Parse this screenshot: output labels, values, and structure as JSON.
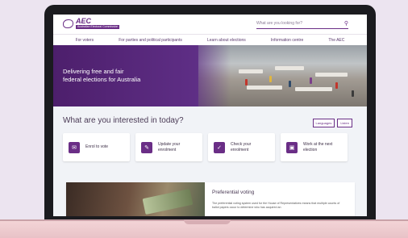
{
  "header": {
    "logo_text": "AEC",
    "logo_sub": "Australian Electoral Commission",
    "search_placeholder": "What are you looking for?"
  },
  "nav": {
    "items": [
      "For voters",
      "For parties and political participants",
      "Learn about elections",
      "Information centre",
      "The AEC"
    ]
  },
  "hero": {
    "line1": "Delivering free and fair",
    "line2": "federal elections for Australia"
  },
  "interest": {
    "heading": "What are you interested in today?",
    "toggle_languages": "Languages",
    "toggle_listen": "Listen"
  },
  "cards": [
    {
      "label": "Enrol to vote",
      "icon": "ballot-icon"
    },
    {
      "label": "Update your enrolment",
      "icon": "edit-icon"
    },
    {
      "label": "Check your enrolment",
      "icon": "user-check-icon"
    },
    {
      "label": "Work at the next election",
      "icon": "briefcase-icon"
    }
  ],
  "feature": {
    "title": "Preferential voting",
    "desc": "The preferential voting system used for the House of Representatives means that multiple counts of ballot papers occur to determine who has acquired an"
  },
  "colors": {
    "brand": "#6a2e86",
    "background": "#ece4f0"
  }
}
